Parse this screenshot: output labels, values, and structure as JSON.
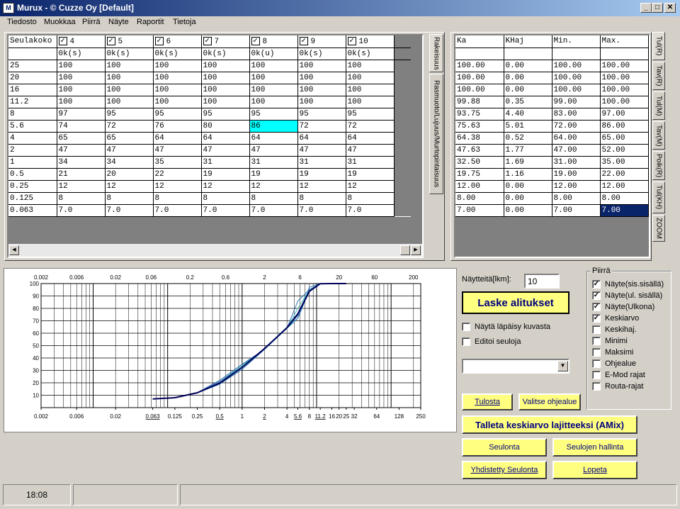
{
  "title": "Murux - © Cuzze Oy [Default]",
  "app_icon": "M",
  "window_controls": {
    "minimize": "_",
    "maximize": "□",
    "close": "✕"
  },
  "menu": [
    "Tiedosto",
    "Muokkaa",
    "Piirrä",
    "Näyte",
    "Raportit",
    "Tietoja"
  ],
  "left_grid": {
    "corner": "Seulakoko",
    "columns": [
      {
        "n": "4",
        "unit": "0k(s)",
        "checked": true
      },
      {
        "n": "5",
        "unit": "0k(s)",
        "checked": true
      },
      {
        "n": "6",
        "unit": "0k(s)",
        "checked": true
      },
      {
        "n": "7",
        "unit": "0k(s)",
        "checked": true
      },
      {
        "n": "8",
        "unit": "0k(u)",
        "checked": true
      },
      {
        "n": "9",
        "unit": "0k(s)",
        "checked": true
      },
      {
        "n": "10",
        "unit": "0k(s)",
        "checked": true
      }
    ],
    "rows": [
      {
        "sieve": "25",
        "v": [
          "100",
          "100",
          "100",
          "100",
          "100",
          "100",
          "100"
        ]
      },
      {
        "sieve": "20",
        "v": [
          "100",
          "100",
          "100",
          "100",
          "100",
          "100",
          "100"
        ]
      },
      {
        "sieve": "16",
        "v": [
          "100",
          "100",
          "100",
          "100",
          "100",
          "100",
          "100"
        ]
      },
      {
        "sieve": "11.2",
        "v": [
          "100",
          "100",
          "100",
          "100",
          "100",
          "100",
          "100"
        ]
      },
      {
        "sieve": "8",
        "v": [
          "97",
          "95",
          "95",
          "95",
          "95",
          "95",
          "95"
        ]
      },
      {
        "sieve": "5.6",
        "v": [
          "74",
          "72",
          "76",
          "80",
          "86",
          "72",
          "72"
        ]
      },
      {
        "sieve": "4",
        "v": [
          "65",
          "65",
          "64",
          "64",
          "64",
          "64",
          "64"
        ]
      },
      {
        "sieve": "2",
        "v": [
          "47",
          "47",
          "47",
          "47",
          "47",
          "47",
          "47"
        ]
      },
      {
        "sieve": "1",
        "v": [
          "34",
          "34",
          "35",
          "31",
          "31",
          "31",
          "31"
        ]
      },
      {
        "sieve": "0.5",
        "v": [
          "21",
          "20",
          "22",
          "19",
          "19",
          "19",
          "19"
        ]
      },
      {
        "sieve": "0.25",
        "v": [
          "12",
          "12",
          "12",
          "12",
          "12",
          "12",
          "12"
        ]
      },
      {
        "sieve": "0.125",
        "v": [
          "8",
          "8",
          "8",
          "8",
          "8",
          "8",
          "8"
        ]
      },
      {
        "sieve": "0.063",
        "v": [
          "7.0",
          "7.0",
          "7.0",
          "7.0",
          "7.0",
          "7.0",
          "7.0"
        ]
      }
    ],
    "highlight": {
      "row": 5,
      "col": 4,
      "color": "#00ffff"
    }
  },
  "left_tabs": [
    "Rakeisuus",
    "Rasmuoto/Lujuus/Murtopintaisuus"
  ],
  "right_grid": {
    "columns": [
      "Ka",
      "KHaj",
      "Min.",
      "Max."
    ],
    "rows": [
      [
        "100.00",
        "0.00",
        "100.00",
        "100.00"
      ],
      [
        "100.00",
        "0.00",
        "100.00",
        "100.00"
      ],
      [
        "100.00",
        "0.00",
        "100.00",
        "100.00"
      ],
      [
        "99.88",
        "0.35",
        "99.00",
        "100.00"
      ],
      [
        "93.75",
        "4.40",
        "83.00",
        "97.00"
      ],
      [
        "75.63",
        "5.01",
        "72.00",
        "86.00"
      ],
      [
        "64.38",
        "0.52",
        "64.00",
        "65.00"
      ],
      [
        "47.63",
        "1.77",
        "47.00",
        "52.00"
      ],
      [
        "32.50",
        "1.69",
        "31.00",
        "35.00"
      ],
      [
        "19.75",
        "1.16",
        "19.00",
        "22.00"
      ],
      [
        "12.00",
        "0.00",
        "12.00",
        "12.00"
      ],
      [
        "8.00",
        "0.00",
        "8.00",
        "8.00"
      ],
      [
        "7.00",
        "0.00",
        "7.00",
        "7.00"
      ]
    ],
    "selected": {
      "row": 12,
      "col": 3,
      "color": "#0a246a"
    }
  },
  "right_tabs": [
    "Tul(R)",
    "Tav(R)",
    "Tul(M)",
    "Tav(M)",
    "Poik(R)",
    "Tul(KH)",
    "ZOOM"
  ],
  "chart_data": {
    "type": "line",
    "x_scale": "log",
    "top_ticks": [
      "0.002",
      "0.006",
      "0.02",
      "0.06",
      "0.2",
      "0.6",
      "2",
      "6",
      "20",
      "60",
      "200"
    ],
    "bottom_ticks": [
      "0.002",
      "0.006",
      "0.02",
      "0.063",
      "0.125",
      "0.25",
      "0.5",
      "1",
      "2",
      "4",
      "5.6",
      "8",
      "11.2",
      "16",
      "20",
      "25",
      "32",
      "64",
      "128",
      "250"
    ],
    "y_ticks": [
      "10",
      "20",
      "30",
      "40",
      "50",
      "60",
      "70",
      "80",
      "90",
      "100"
    ],
    "xlim": [
      0.002,
      250
    ],
    "ylim": [
      0,
      100
    ],
    "grid": true,
    "x": [
      0.063,
      0.125,
      0.25,
      0.5,
      1,
      2,
      4,
      5.6,
      8,
      11.2,
      16,
      20,
      25
    ],
    "series": [
      {
        "values": [
          7,
          8,
          12,
          21,
          34,
          47,
          65,
          74,
          97,
          100,
          100,
          100,
          100
        ]
      },
      {
        "values": [
          7,
          8,
          12,
          20,
          34,
          47,
          65,
          72,
          95,
          100,
          100,
          100,
          100
        ]
      },
      {
        "values": [
          7,
          8,
          12,
          22,
          35,
          47,
          64,
          76,
          95,
          100,
          100,
          100,
          100
        ]
      },
      {
        "values": [
          7,
          8,
          12,
          19,
          31,
          47,
          64,
          80,
          95,
          100,
          100,
          100,
          100
        ]
      },
      {
        "values": [
          7,
          8,
          12,
          19,
          31,
          47,
          64,
          86,
          95,
          100,
          100,
          100,
          100
        ]
      },
      {
        "values": [
          7,
          8,
          12,
          19,
          31,
          47,
          64,
          72,
          95,
          100,
          100,
          100,
          100
        ]
      },
      {
        "values": [
          7,
          8,
          12,
          19,
          31,
          47,
          64,
          72,
          95,
          100,
          100,
          100,
          100
        ]
      },
      {
        "values": [
          7,
          8,
          12,
          19.75,
          32.5,
          47.63,
          64.38,
          75.63,
          93.75,
          99.88,
          100,
          100,
          100
        ]
      }
    ],
    "colors": {
      "sample": "#2f6fb0",
      "light": "#40c0c0",
      "mean": "#00005a"
    }
  },
  "controls": {
    "naytteita_label": "Näytteitä[lkm]:",
    "naytteita_value": "10",
    "laske_label": "Laske alitukset",
    "nayta_lapaisy": "Näytä läpäisy kuvasta",
    "editoi_seuloja": "Editoi seuloja",
    "dropdown_value": "",
    "tulosta": "Tulosta",
    "valitse_ohjealue": "Valitse ohjealue",
    "talleta": "Talleta keskiarvo lajitteeksi (AMix)",
    "seulonta": "Seulonta",
    "seulojen_hallinta": "Seulojen hallinta",
    "yhdistetty": "Yhdistetty Seulonta",
    "lopeta": "Lopeta"
  },
  "piirra": {
    "legend": "Piirrä",
    "items": [
      {
        "label": "Näyte(sis.sisällä)",
        "checked": true
      },
      {
        "label": "Näyte(ul. sisällä)",
        "checked": true
      },
      {
        "label": "Näyte(Ulkona)",
        "checked": true
      },
      {
        "label": "Keskiarvo",
        "checked": true
      },
      {
        "label": "Keskihaj.",
        "checked": false
      },
      {
        "label": "Minimi",
        "checked": false
      },
      {
        "label": "Maksimi",
        "checked": false
      },
      {
        "label": "Ohjealue",
        "checked": false
      },
      {
        "label": "E-Mod rajat",
        "checked": false
      },
      {
        "label": "Routa-rajat",
        "checked": false
      }
    ]
  },
  "status": {
    "time": "18:08",
    "panel2": "",
    "panel3": ""
  }
}
